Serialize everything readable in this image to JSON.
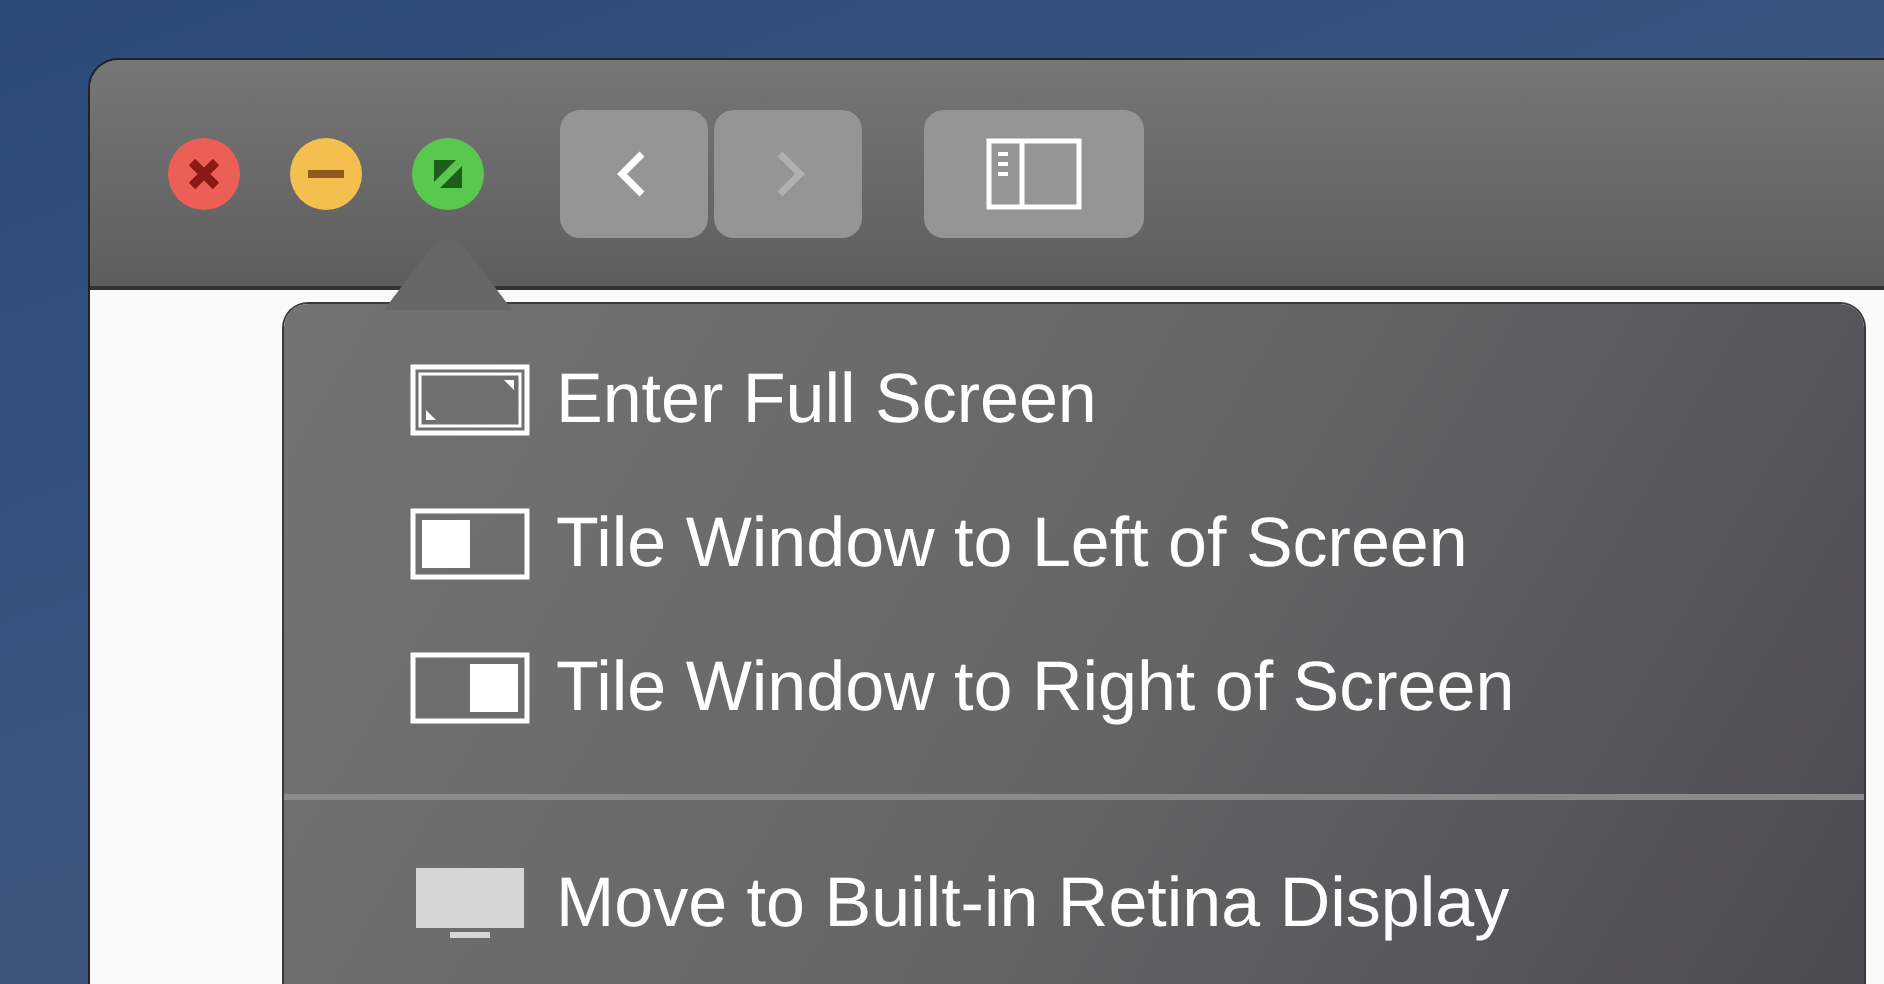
{
  "window": {
    "controls": [
      {
        "kind": "close"
      },
      {
        "kind": "minimize"
      },
      {
        "kind": "fullscreen"
      }
    ],
    "nav_buttons": [
      {
        "kind": "back",
        "disabled": false
      },
      {
        "kind": "forward",
        "disabled": true
      }
    ],
    "toolbar_buttons": [
      {
        "kind": "sidebar"
      }
    ]
  },
  "menu": {
    "sections": [
      {
        "items": [
          {
            "kind": "fullscreen",
            "label": "Enter Full Screen"
          },
          {
            "kind": "tile-left",
            "label": "Tile Window to Left of Screen"
          },
          {
            "kind": "tile-right",
            "label": "Tile Window to Right of Screen"
          }
        ]
      },
      {
        "items": [
          {
            "kind": "display",
            "label": "Move to Built-in Retina Display"
          }
        ]
      }
    ]
  }
}
